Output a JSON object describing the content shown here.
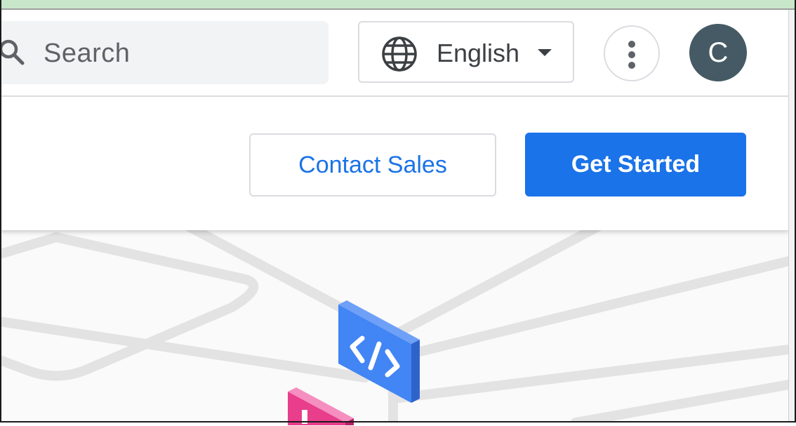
{
  "search": {
    "placeholder": "Search",
    "icon": "search-icon"
  },
  "language": {
    "label": "English",
    "icon": "globe-icon",
    "dropdown_icon": "caret-down-icon"
  },
  "menu": {
    "icon": "more-vert-icon"
  },
  "account": {
    "avatar_letter": "C",
    "avatar_color": "#455a64"
  },
  "actions": {
    "contact_label": "Contact Sales",
    "get_started_label": "Get Started"
  },
  "hero": {
    "illustrations": [
      "code-block-icon",
      "pink-block-icon"
    ],
    "code_block_color": "#4285f4",
    "pink_block_color": "#e83e8c"
  },
  "colors": {
    "primary": "#1a73e8",
    "border": "#dadce0",
    "text_secondary": "#5f6368"
  }
}
